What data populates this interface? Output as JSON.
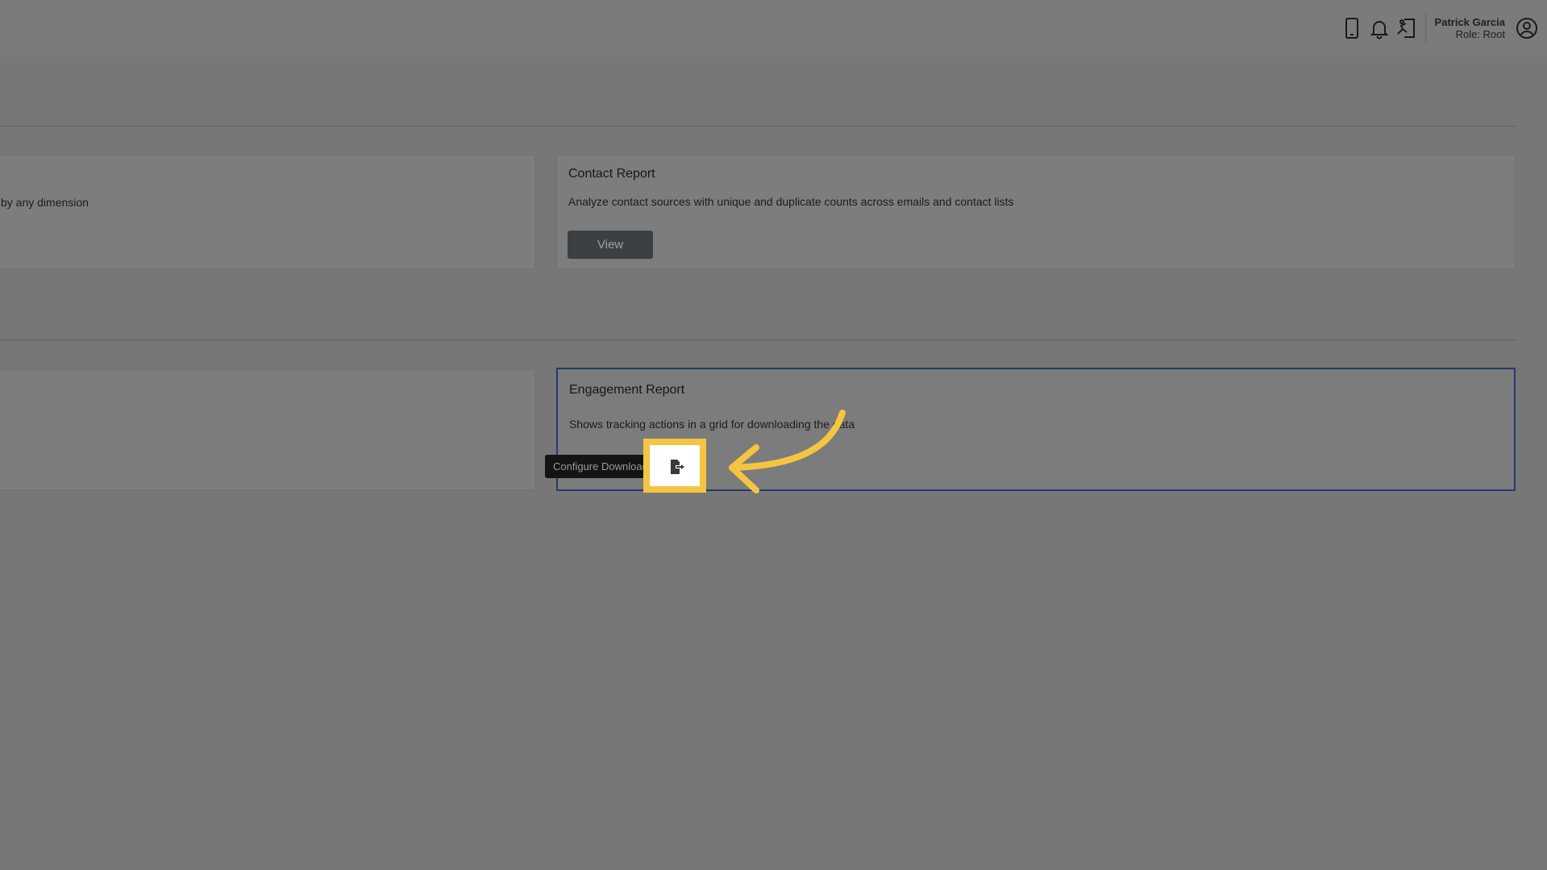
{
  "header": {
    "user_name": "Patrick Garcia",
    "user_role": "Role: Root",
    "icons": [
      "mobile-icon",
      "bell-icon",
      "exit-icon",
      "user-circle-icon"
    ]
  },
  "cards": {
    "left_top": {
      "description": "by any dimension"
    },
    "contact": {
      "title": "Contact Report",
      "description": "Analyze contact sources with unique and duplicate counts across emails and contact lists",
      "view_label": "View"
    },
    "engagement": {
      "title": "Engagement Report",
      "description": "Shows tracking actions in a grid for downloading the data",
      "tooltip": "Configure Download"
    }
  },
  "colors": {
    "highlight": "#f5c542",
    "selected_border": "#243b6b",
    "button": "#3d4043"
  }
}
